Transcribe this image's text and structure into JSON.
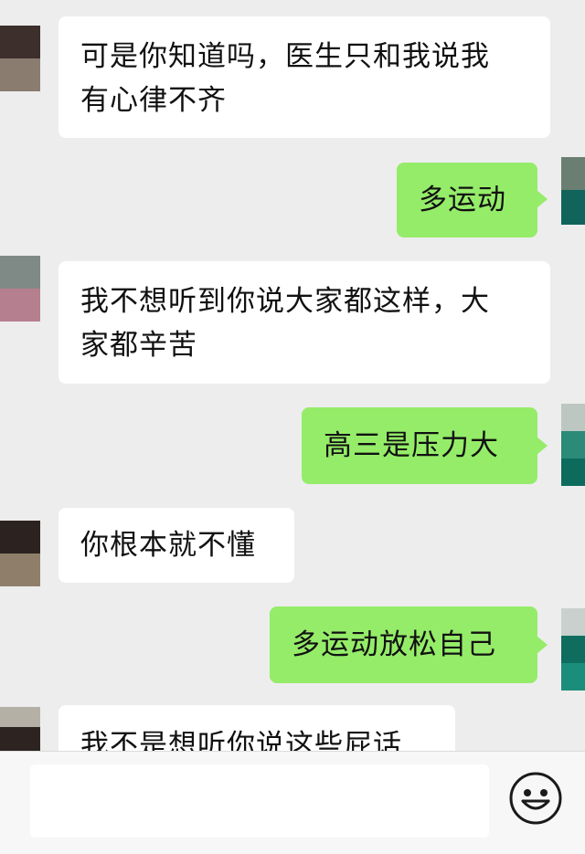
{
  "conversation": {
    "messages": [
      {
        "side": "received",
        "text": "可是你知道吗，医生只和我说我\n有心律不齐"
      },
      {
        "side": "sent",
        "text": "多运动"
      },
      {
        "side": "received",
        "text": "我不想听到你说大家都这样，大\n家都辛苦"
      },
      {
        "side": "sent",
        "text": "高三是压力大"
      },
      {
        "side": "received",
        "text": "你根本就不懂"
      },
      {
        "side": "sent",
        "text": "多运动放松自己"
      },
      {
        "side": "received",
        "text": "我不是想听你说这些屁话"
      }
    ]
  },
  "input_bar": {
    "text_value": "",
    "emoji_icon": "smiley-face-icon"
  },
  "colors": {
    "background": "#ededed",
    "received_bubble": "#ffffff",
    "sent_bubble": "#95ec69",
    "text": "#111111"
  }
}
